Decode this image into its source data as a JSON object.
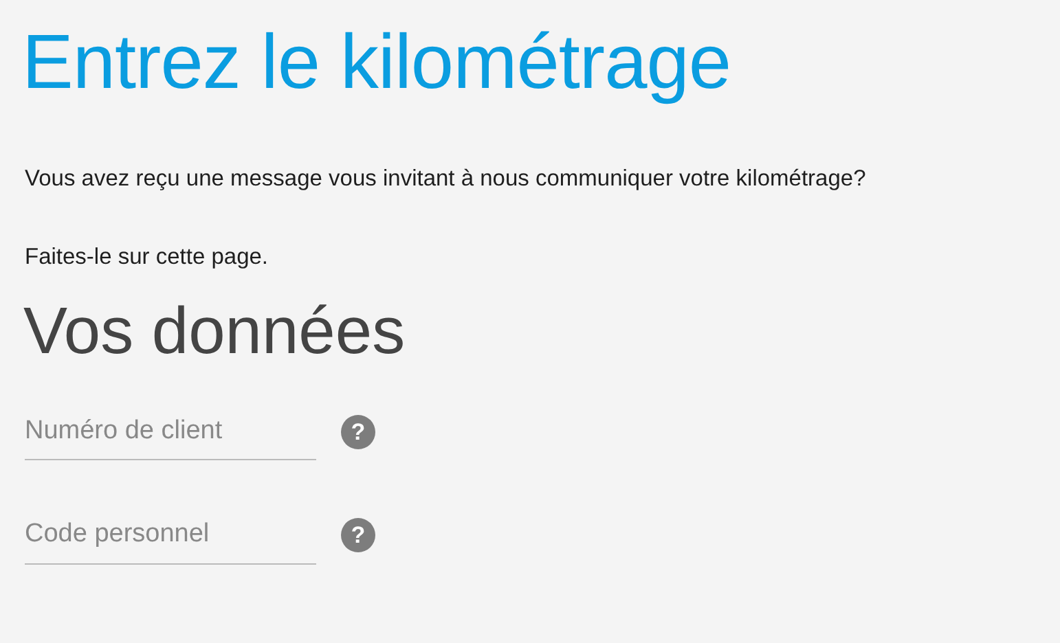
{
  "title": "Entrez le kilométrage",
  "intro": [
    "Vous avez reçu une message vous invitant à nous communiquer votre kilométrage?",
    "Faites-le sur cette page."
  ],
  "section_title": "Vos données",
  "fields": [
    {
      "placeholder": "Numéro de client",
      "help": "?"
    },
    {
      "placeholder": "Code personnel",
      "help": "?"
    }
  ]
}
